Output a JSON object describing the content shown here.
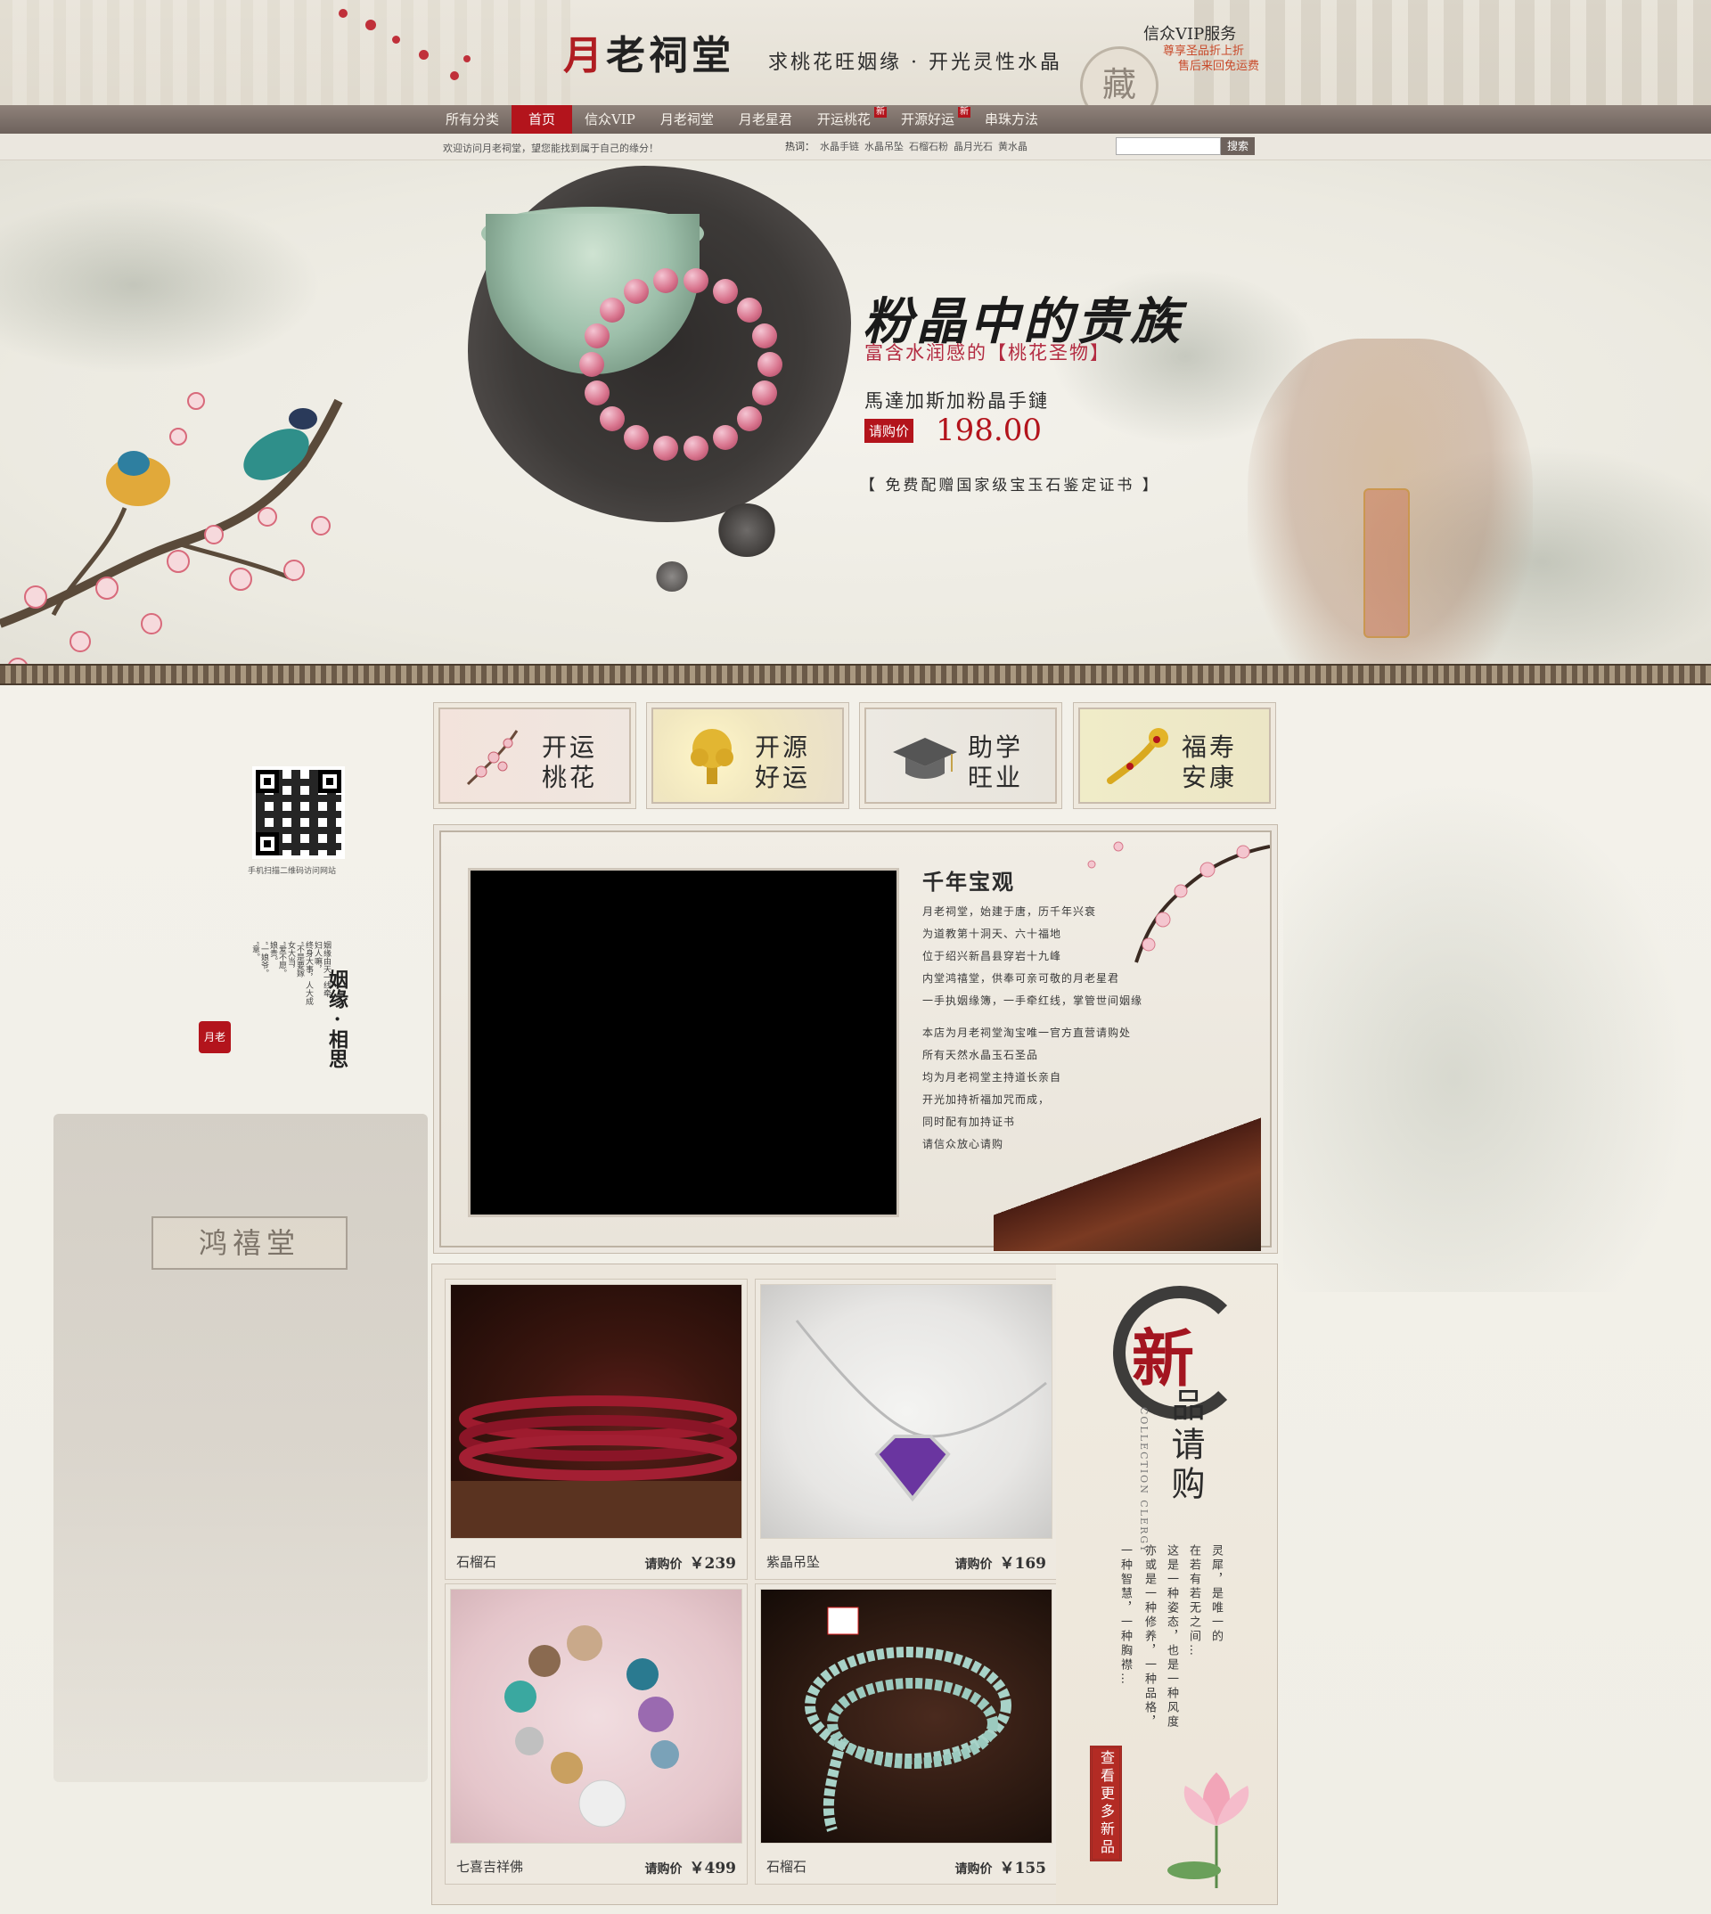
{
  "header": {
    "logo_first": "月",
    "logo_rest": "老祠堂",
    "slogan": "求桃花旺姻缘 · 开光灵性水晶",
    "seal_char": "藏",
    "vip": {
      "title": "信众VIP服务",
      "line1": "尊享圣品折上折",
      "line2": "售后来回免运费"
    }
  },
  "nav": {
    "items": [
      {
        "label": "所有分类",
        "active": false,
        "new": false
      },
      {
        "label": "首页",
        "active": true,
        "new": false
      },
      {
        "label": "信众VIP",
        "active": false,
        "new": false
      },
      {
        "label": "月老祠堂",
        "active": false,
        "new": false
      },
      {
        "label": "月老星君",
        "active": false,
        "new": false
      },
      {
        "label": "开运桃花",
        "active": false,
        "new": true
      },
      {
        "label": "开源好运",
        "active": false,
        "new": true
      },
      {
        "label": "串珠方法",
        "active": false,
        "new": false
      }
    ],
    "new_tag": "新"
  },
  "infobar": {
    "welcome": "欢迎访问月老祠堂，望您能找到属于自己的缘分！",
    "hot_label": "热词：",
    "hot_words": [
      "水晶手链",
      "水晶吊坠",
      "石榴石粉",
      "晶月光石",
      "黄水晶"
    ],
    "search_placeholder": "",
    "search_button": "搜索"
  },
  "banner": {
    "title": "粉晶中的贵族",
    "subtitle": "富含水润感的【桃花圣物】",
    "product": "馬達加斯加粉晶手鏈",
    "price_tag": "请购价",
    "price": "198.00",
    "cert": "【 免费配赠国家级宝玉石鉴定证书 】"
  },
  "sidebar": {
    "qr_label": "手机扫描二维码访问网站",
    "poem_title": "姻缘 · 相思",
    "poem_cols": [
      "“意。",
      "“一娘爷。",
      "娘贵。",
      "“爱不愿。",
      "女大当，",
      "“不是要嫁",
      "终身大事，人大成",
      "妇人嘛，",
      "姻缘由天一线牵"
    ],
    "seal_text": "月老",
    "temple_plaque": "鸿禧堂"
  },
  "categories": [
    {
      "line1": "开运",
      "line2": "桃花"
    },
    {
      "line1": "开源",
      "line2": "好运"
    },
    {
      "line1": "助学",
      "line2": "旺业"
    },
    {
      "line1": "福寿",
      "line2": "安康"
    }
  ],
  "heritage": {
    "title": "千年宝观",
    "lines1": [
      "月老祠堂，始建于唐，历千年兴衰",
      "为道教第十洞天、六十福地",
      "位于绍兴新昌县穿岩十九峰",
      "内堂鸿禧堂，供奉可亲可敬的月老星君",
      "一手执姻缘簿，一手牵红线，掌管世间姻缘"
    ],
    "lines2": [
      "本店为月老祠堂淘宝唯一官方直营请购处",
      "所有天然水晶玉石圣品",
      "均为月老祠堂主持道长亲自",
      "开光加持祈福加咒而成，",
      "同时配有加持证书",
      "请信众放心请购"
    ]
  },
  "new_products": {
    "big_char": "新",
    "title_rest": "品请购",
    "english": "COLLECTION CLERGY",
    "verse": [
      "灵犀，是唯一的",
      "在若有若无之间…",
      "这是一种姿态，也是一种风度",
      "亦或是一种修养，一种品格，",
      "一种智慧，一种胸襟…"
    ],
    "more_button": "查看更多新品",
    "price_label": "请购价",
    "items": [
      {
        "name": "石榴石",
        "price": "￥239"
      },
      {
        "name": "紫晶吊坠",
        "price": "￥169"
      },
      {
        "name": "七喜吉祥佛",
        "price": "￥499"
      },
      {
        "name": "石榴石",
        "price": "￥155"
      }
    ]
  },
  "colors": {
    "accent": "#b3141c",
    "nav_bg": "#7b6f68",
    "price_red": "#b3141c"
  }
}
